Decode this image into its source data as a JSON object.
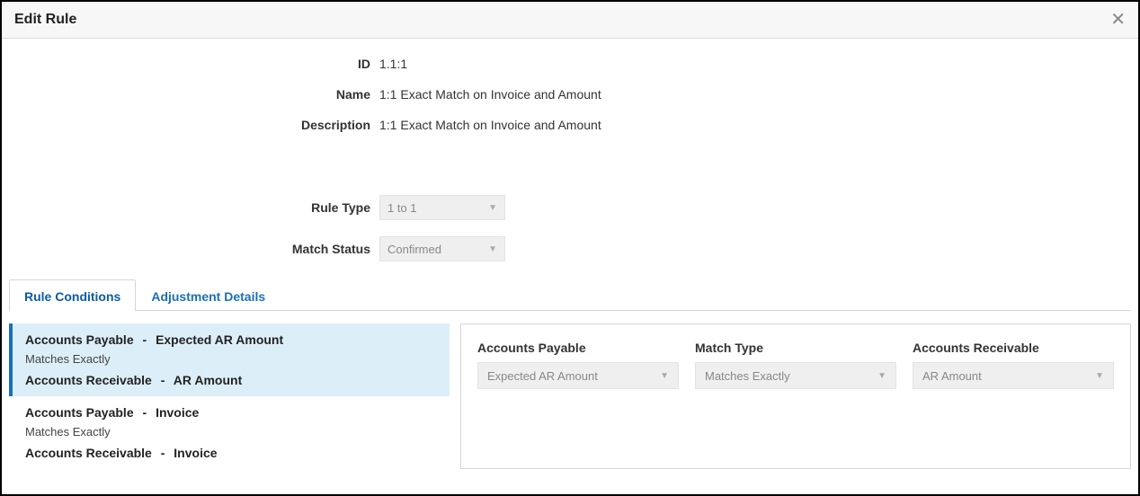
{
  "dialog": {
    "title": "Edit Rule"
  },
  "form": {
    "id_label": "ID",
    "id_value": "1.1:1",
    "name_label": "Name",
    "name_value": "1:1 Exact Match on Invoice and Amount",
    "desc_label": "Description",
    "desc_value": "1:1 Exact Match on Invoice and Amount",
    "ruletype_label": "Rule Type",
    "ruletype_value": "1 to 1",
    "matchstatus_label": "Match Status",
    "matchstatus_value": "Confirmed"
  },
  "tabs": {
    "conditions": "Rule Conditions",
    "adjustment": "Adjustment Details"
  },
  "conditions": [
    {
      "source_a": "Accounts Payable",
      "field_a": "Expected AR Amount",
      "match_text": "Matches Exactly",
      "source_b": "Accounts Receivable",
      "field_b": "AR Amount",
      "selected": true
    },
    {
      "source_a": "Accounts Payable",
      "field_a": "Invoice",
      "match_text": "Matches Exactly",
      "source_b": "Accounts Receivable",
      "field_b": "Invoice",
      "selected": false
    }
  ],
  "detail": {
    "ap_label": "Accounts Payable",
    "ap_value": "Expected AR Amount",
    "mt_label": "Match Type",
    "mt_value": "Matches Exactly",
    "ar_label": "Accounts Receivable",
    "ar_value": "AR Amount"
  },
  "sep": "-"
}
